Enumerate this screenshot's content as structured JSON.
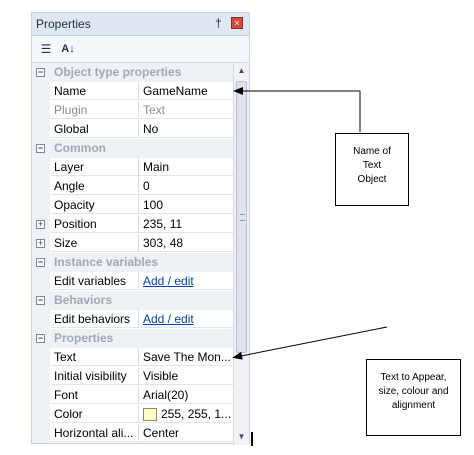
{
  "panel": {
    "title": "Properties",
    "pin_glyph": "†",
    "close_glyph": "×",
    "toolbar": {
      "categorized_icon": "categorized-icon",
      "alphabetical_icon": "alphabetical-icon",
      "categorized_glyph": "☰",
      "alphabetical_glyph": "A↓"
    }
  },
  "grid": {
    "rows": [
      {
        "type": "category",
        "label": "Object type properties",
        "expander": "−"
      },
      {
        "type": "prop",
        "name": "Name",
        "value": "GameName"
      },
      {
        "type": "prop",
        "name": "Plugin",
        "value": "Text",
        "readonly": true
      },
      {
        "type": "prop",
        "name": "Global",
        "value": "No"
      },
      {
        "type": "category",
        "label": "Common",
        "expander": "−"
      },
      {
        "type": "prop",
        "name": "Layer",
        "value": "Main"
      },
      {
        "type": "prop",
        "name": "Angle",
        "value": "0"
      },
      {
        "type": "prop",
        "name": "Opacity",
        "value": "100"
      },
      {
        "type": "prop",
        "name": "Position",
        "value": "235, 11",
        "expander": "+"
      },
      {
        "type": "prop",
        "name": "Size",
        "value": "303, 48",
        "expander": "+"
      },
      {
        "type": "category",
        "label": "Instance variables",
        "expander": "−"
      },
      {
        "type": "prop",
        "name": "Edit variables",
        "value": "Add / edit",
        "link": true
      },
      {
        "type": "category",
        "label": "Behaviors",
        "expander": "−"
      },
      {
        "type": "prop",
        "name": "Edit behaviors",
        "value": "Add / edit",
        "link": true
      },
      {
        "type": "category",
        "label": "Properties",
        "expander": "−"
      },
      {
        "type": "prop",
        "name": "Text",
        "value": "Save The Mon..."
      },
      {
        "type": "prop",
        "name": "Initial visibility",
        "value": "Visible"
      },
      {
        "type": "prop",
        "name": "Font",
        "value": "Arial(20)"
      },
      {
        "type": "prop",
        "name": "Color",
        "value": "255, 255, 1...",
        "swatch_color": "#ffffc8"
      },
      {
        "type": "prop",
        "name": "Horizontal ali...",
        "value": "Center"
      }
    ]
  },
  "scrollbar": {
    "up_glyph": "▲",
    "down_glyph": "▼"
  },
  "annotations": {
    "name_note": [
      "Name of",
      "Text",
      "Object"
    ],
    "text_note": [
      "Text to Appear,",
      "size, colour and",
      "alignment"
    ]
  }
}
